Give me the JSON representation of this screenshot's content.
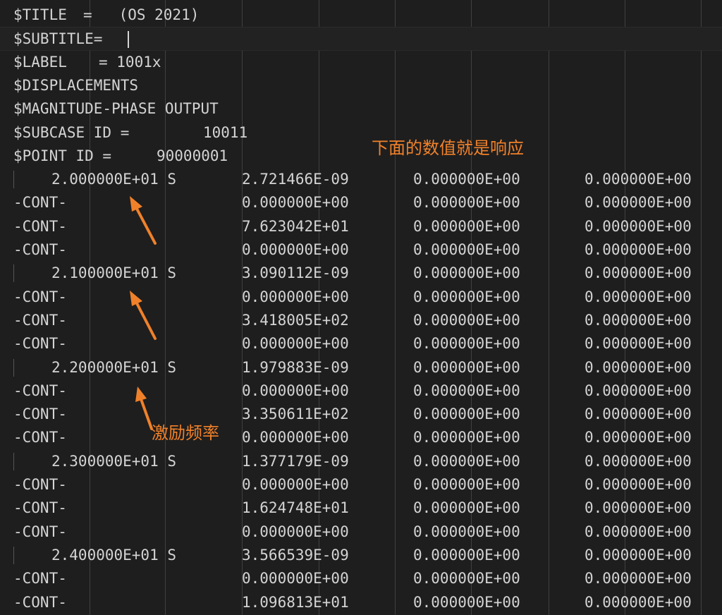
{
  "header_lines": [
    {
      "label": "$TITLE",
      "value": "=   (OS 2021)",
      "value_col": 118
    },
    {
      "label": "$SUBTITLE=",
      "value": "",
      "value_col": 0
    },
    {
      "label": "$LABEL",
      "value": "= 1001x",
      "value_col": 140
    },
    {
      "label": "$DISPLACEMENTS",
      "value": "",
      "value_col": 0
    },
    {
      "label": "$MAGNITUDE-PHASE OUTPUT",
      "value": "",
      "value_col": 0
    },
    {
      "label": "$SUBCASE ID =",
      "value": "10011",
      "value_col": 288
    },
    {
      "label": "$POINT ID =",
      "value": "90000001",
      "value_col": 222
    }
  ],
  "data_rows": [
    {
      "key": "2.000000E+01 S",
      "c1": "2.721466E-09",
      "c2": "0.000000E+00",
      "c3": "0.000000E+00"
    },
    {
      "key": "-CONT-",
      "c1": "0.000000E+00",
      "c2": "0.000000E+00",
      "c3": "0.000000E+00"
    },
    {
      "key": "-CONT-",
      "c1": "7.623042E+01",
      "c2": "0.000000E+00",
      "c3": "0.000000E+00"
    },
    {
      "key": "-CONT-",
      "c1": "0.000000E+00",
      "c2": "0.000000E+00",
      "c3": "0.000000E+00"
    },
    {
      "key": "2.100000E+01 S",
      "c1": "3.090112E-09",
      "c2": "0.000000E+00",
      "c3": "0.000000E+00"
    },
    {
      "key": "-CONT-",
      "c1": "0.000000E+00",
      "c2": "0.000000E+00",
      "c3": "0.000000E+00"
    },
    {
      "key": "-CONT-",
      "c1": "3.418005E+02",
      "c2": "0.000000E+00",
      "c3": "0.000000E+00"
    },
    {
      "key": "-CONT-",
      "c1": "0.000000E+00",
      "c2": "0.000000E+00",
      "c3": "0.000000E+00"
    },
    {
      "key": "2.200000E+01 S",
      "c1": "1.979883E-09",
      "c2": "0.000000E+00",
      "c3": "0.000000E+00"
    },
    {
      "key": "-CONT-",
      "c1": "0.000000E+00",
      "c2": "0.000000E+00",
      "c3": "0.000000E+00"
    },
    {
      "key": "-CONT-",
      "c1": "3.350611E+02",
      "c2": "0.000000E+00",
      "c3": "0.000000E+00"
    },
    {
      "key": "-CONT-",
      "c1": "0.000000E+00",
      "c2": "0.000000E+00",
      "c3": "0.000000E+00"
    },
    {
      "key": "2.300000E+01 S",
      "c1": "1.377179E-09",
      "c2": "0.000000E+00",
      "c3": "0.000000E+00"
    },
    {
      "key": "-CONT-",
      "c1": "0.000000E+00",
      "c2": "0.000000E+00",
      "c3": "0.000000E+00"
    },
    {
      "key": "-CONT-",
      "c1": "1.624748E+01",
      "c2": "0.000000E+00",
      "c3": "0.000000E+00"
    },
    {
      "key": "-CONT-",
      "c1": "0.000000E+00",
      "c2": "0.000000E+00",
      "c3": "0.000000E+00"
    },
    {
      "key": "2.400000E+01 S",
      "c1": "3.566539E-09",
      "c2": "0.000000E+00",
      "c3": "0.000000E+00"
    },
    {
      "key": "-CONT-",
      "c1": "0.000000E+00",
      "c2": "0.000000E+00",
      "c3": "0.000000E+00"
    },
    {
      "key": "-CONT-",
      "c1": "1.096813E+01",
      "c2": "0.000000E+00",
      "c3": "0.000000E+00"
    }
  ],
  "annotations": {
    "response_note": "下面的数值就是响应",
    "frequency_note": "激励频率"
  },
  "colors": {
    "background": "#1e1e1e",
    "text": "#d4d4d4",
    "annotation": "#f0812a",
    "indent_guide": "#404040"
  }
}
